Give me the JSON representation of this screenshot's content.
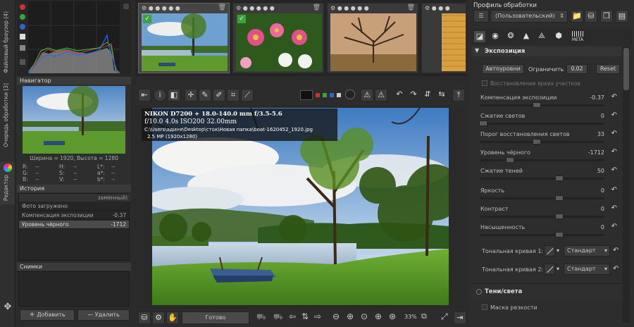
{
  "left_tabs": {
    "file_browser": "Файловый браузер (4)",
    "queue": "Очередь обработки [3]",
    "editor": "Редактор"
  },
  "navigator": {
    "title": "Навигатор",
    "size_text": "Ширина = 1920, Высота = 1280",
    "rgb": [
      [
        "R:",
        "--",
        "H:",
        "--",
        "L*:",
        "--"
      ],
      [
        "G:",
        "--",
        "S:",
        "--",
        "a*:",
        "--"
      ],
      [
        "B:",
        "--",
        "V:",
        "--",
        "b*:",
        "--"
      ]
    ]
  },
  "history": {
    "title": "История",
    "col_header": "заменный)",
    "rows": [
      {
        "label": "Фото загружено",
        "value": ""
      },
      {
        "label": "Компенсация экспозиции",
        "value": "-0.37"
      },
      {
        "label": "Уровень чёрного",
        "value": "-1712"
      }
    ]
  },
  "snapshots": {
    "title": "Снимки",
    "add": "Добавить",
    "remove": "Удалить"
  },
  "exif": {
    "line1": "NIKON D7200 + 18.0-140.0 mm f/3.5-5.6",
    "line2": "f/10.0  4.0s  ISO200  32.00mm",
    "line3": "C:\\Users\\адиня\\Desktop\\сток\\Новая папка\\boat-1620452_1920.jpg",
    "line4": "2.5 MP (1920x1280)"
  },
  "bottom": {
    "status": "Готово",
    "zoom": "33%"
  },
  "profile": {
    "title": "Профиль обработки",
    "value": "(Пользовательский)"
  },
  "exposure": {
    "title": "Экспозиция",
    "auto_levels": "Автоуровни",
    "clip_label": "Ограничить",
    "clip_value": "0.02",
    "reset": "Reset",
    "highlight_recon": "Восстановление ярких участков",
    "sliders": [
      {
        "label": "Компенсация экспозиции",
        "value": "-0.37"
      },
      {
        "label": "Сжатие светов",
        "value": "0"
      },
      {
        "label": "Порог восстановления светов",
        "value": "33"
      },
      {
        "label": "Уровень чёрного",
        "value": "-1712"
      },
      {
        "label": "Сжатие теней",
        "value": "50"
      },
      {
        "label": "Яркость",
        "value": "0"
      },
      {
        "label": "Контраст",
        "value": "0"
      },
      {
        "label": "Насыщенность",
        "value": "0"
      }
    ],
    "curve1": "Тональная кривая 1:",
    "curve2": "Тональная кривая 2:",
    "curve_mode": "Стандарт"
  },
  "shadows": {
    "title": "Тени/света"
  },
  "sharpen": {
    "title": "Маска резкости"
  },
  "tool_tab_meta": "META"
}
